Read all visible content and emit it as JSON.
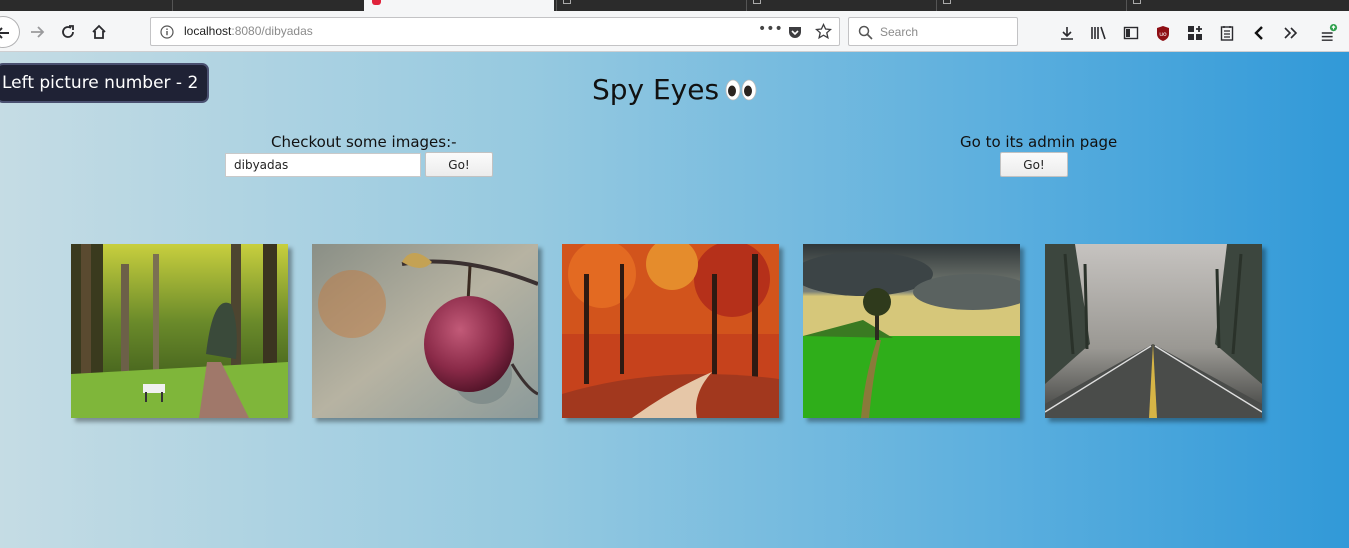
{
  "browser": {
    "url_host": "localhost",
    "url_path": ":8080/dibyadas",
    "search_placeholder": "Search",
    "page_actions_label": "•••"
  },
  "toast": {
    "text": "Left picture number - 2"
  },
  "header": {
    "title": "Spy Eyes"
  },
  "left_panel": {
    "label": "Checkout some images:-",
    "input_value": "dibyadas",
    "button_label": "Go!"
  },
  "right_panel": {
    "label": "Go to its admin page",
    "button_label": "Go!"
  },
  "gallery": {
    "images": [
      {
        "subject": "forest-path-with-bench"
      },
      {
        "subject": "red-apple-on-branch"
      },
      {
        "subject": "autumn-forest-road"
      },
      {
        "subject": "green-field-tree-cloudy-sky"
      },
      {
        "subject": "wet-road-through-pine-forest"
      }
    ]
  },
  "colors": {
    "toast_bg": "#1f2235",
    "gradient_start": "#c5dce4",
    "gradient_end": "#3199d8",
    "tab_accent": "#e0233b"
  }
}
